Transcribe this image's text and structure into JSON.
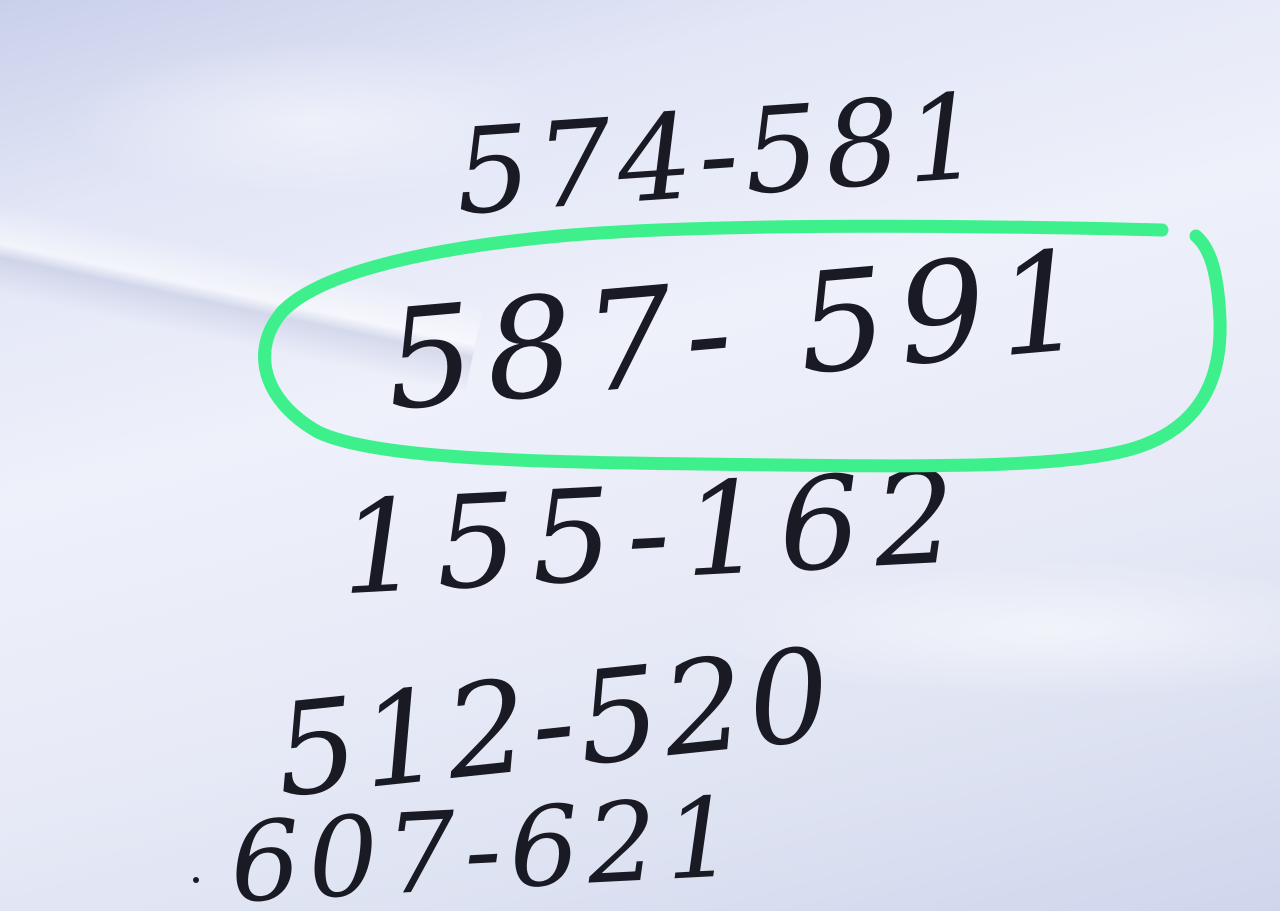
{
  "photo": {
    "paper_color": "#e8ebf7",
    "ink_color": "#1a1a24",
    "highlight_color": "#3df08c"
  },
  "lines": [
    {
      "text": "574-581"
    },
    {
      "text": "587- 591"
    },
    {
      "text": "155-162"
    },
    {
      "text": "512-520"
    },
    {
      "text": "607-621"
    }
  ]
}
